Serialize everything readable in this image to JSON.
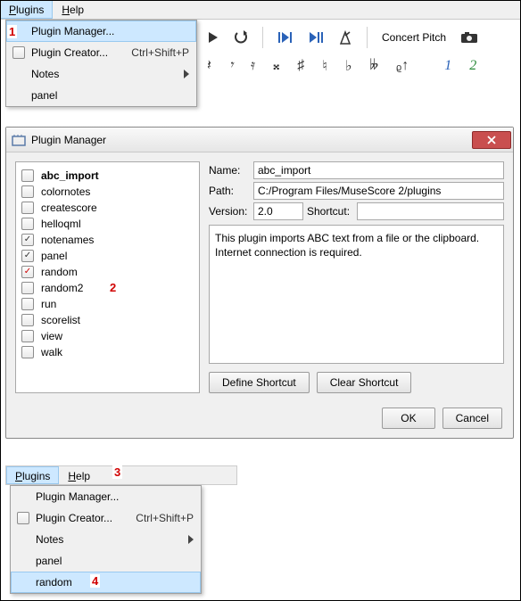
{
  "menubar": {
    "plugins": "Plugins",
    "help": "Help"
  },
  "menu1": {
    "manager": "Plugin Manager...",
    "creator": "Plugin Creator...",
    "creator_shortcut": "Ctrl+Shift+P",
    "notes": "Notes",
    "panel": "panel"
  },
  "toolbar": {
    "concert": "Concert Pitch"
  },
  "dialog": {
    "title": "Plugin Manager",
    "plugins": [
      {
        "name": "abc_import",
        "checked": false,
        "bold": true
      },
      {
        "name": "colornotes",
        "checked": false
      },
      {
        "name": "createscore",
        "checked": false
      },
      {
        "name": "helloqml",
        "checked": false
      },
      {
        "name": "notenames",
        "checked": true
      },
      {
        "name": "panel",
        "checked": true
      },
      {
        "name": "random",
        "checked": true,
        "red": true
      },
      {
        "name": "random2",
        "checked": false
      },
      {
        "name": "run",
        "checked": false
      },
      {
        "name": "scorelist",
        "checked": false
      },
      {
        "name": "view",
        "checked": false
      },
      {
        "name": "walk",
        "checked": false
      }
    ],
    "labels": {
      "name": "Name:",
      "path": "Path:",
      "version": "Version:",
      "shortcut": "Shortcut:"
    },
    "fields": {
      "name": "abc_import",
      "path": "C:/Program Files/MuseScore 2/plugins",
      "version": "2.0",
      "shortcut": ""
    },
    "description": "This plugin imports ABC text from a file or the clipboard. Internet connection is required.",
    "buttons": {
      "define": "Define Shortcut",
      "clear": "Clear Shortcut",
      "ok": "OK",
      "cancel": "Cancel"
    }
  },
  "menu2": {
    "manager": "Plugin Manager...",
    "creator": "Plugin Creator...",
    "creator_shortcut": "Ctrl+Shift+P",
    "notes": "Notes",
    "panel": "panel",
    "random": "random"
  },
  "annot": {
    "a1": "1",
    "a2": "2",
    "a3": "3",
    "a4": "4"
  }
}
